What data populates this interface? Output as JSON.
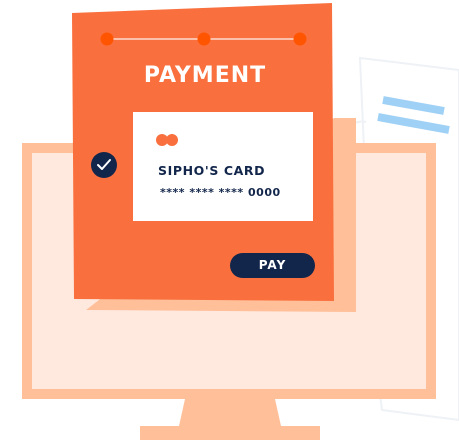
{
  "payment": {
    "title": "PAYMENT",
    "card_name": "SIPHO'S CARD",
    "card_number": "**** **** **** 0000",
    "pay_label": "PAY"
  },
  "colors": {
    "orange": "#f9703e",
    "peach": "#ffbf99",
    "cream": "#ffe9df",
    "navy": "#12264b",
    "light_blue": "#9fd0f5"
  },
  "icons": {
    "check": "check-icon",
    "card_brand": "card-brand-icon"
  }
}
